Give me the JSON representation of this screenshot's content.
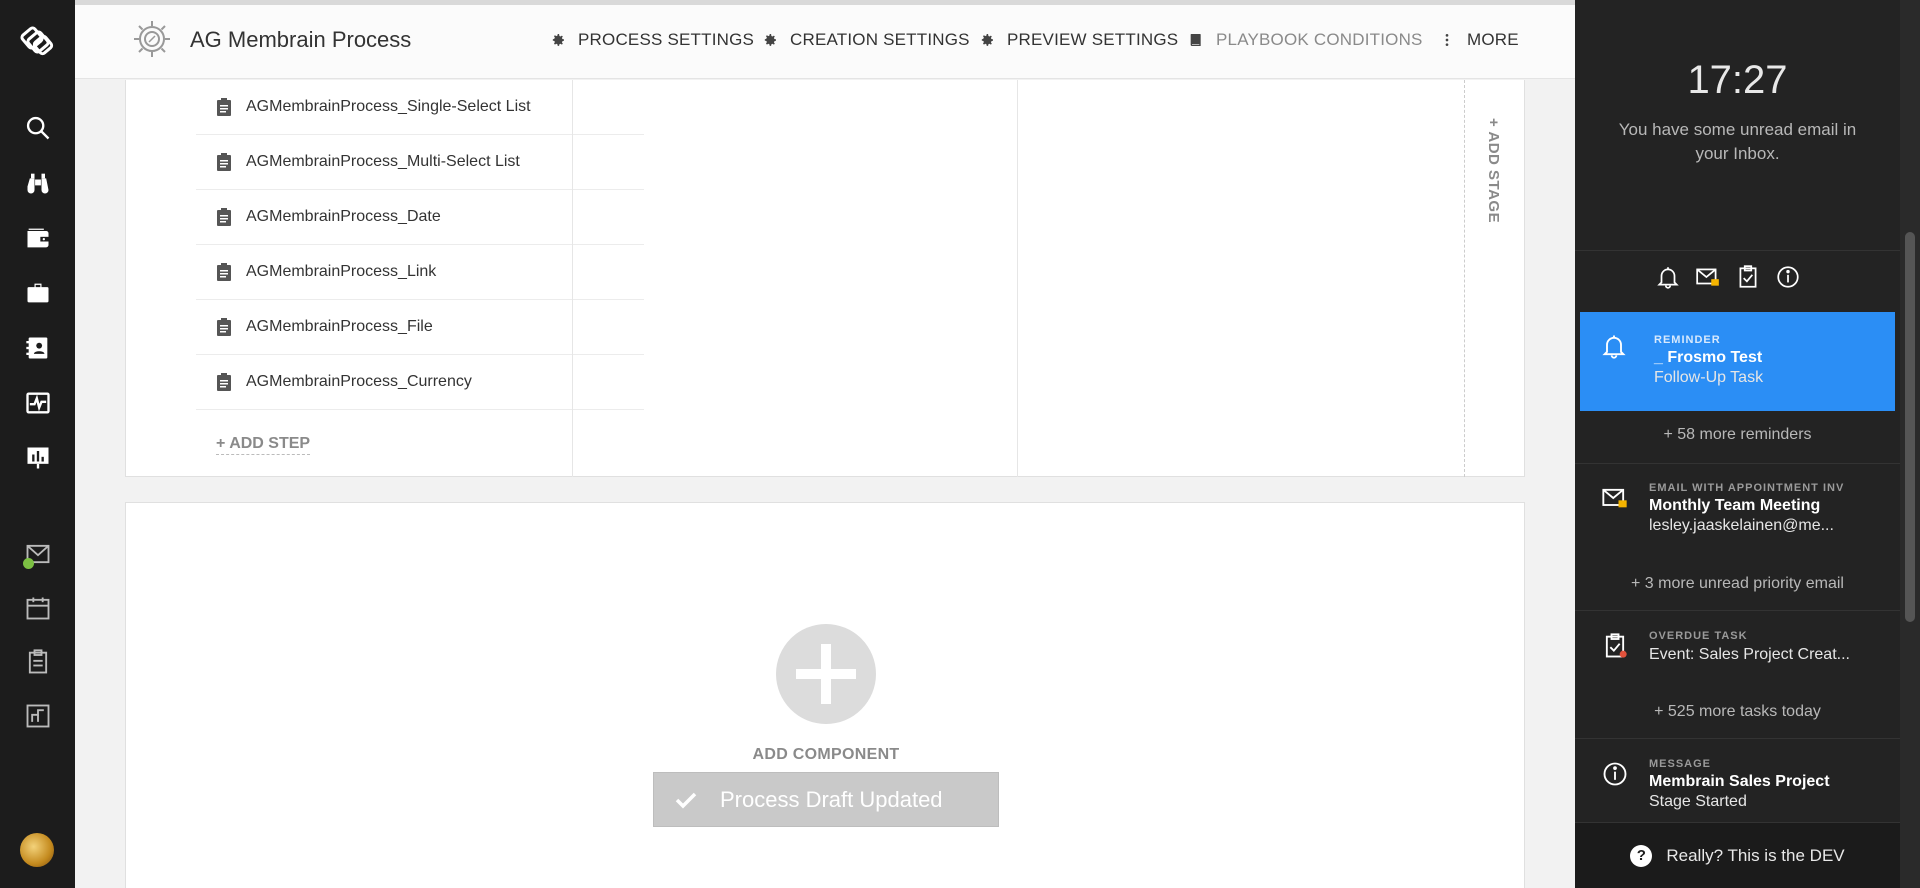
{
  "app": {
    "title": "AG Membrain Process"
  },
  "topmenu": [
    {
      "label": "PROCESS SETTINGS",
      "icon": "gear-icon"
    },
    {
      "label": "CREATION SETTINGS",
      "icon": "gear-icon"
    },
    {
      "label": "PREVIEW SETTINGS",
      "icon": "gear-icon"
    },
    {
      "label": "PLAYBOOK CONDITIONS",
      "icon": "book-icon"
    },
    {
      "label": "MORE",
      "icon": "kebab-icon"
    }
  ],
  "steps": [
    {
      "label": "AGMembrainProcess_Single-Select List"
    },
    {
      "label": "AGMembrainProcess_Multi-Select List"
    },
    {
      "label": "AGMembrainProcess_Date"
    },
    {
      "label": "AGMembrainProcess_Link"
    },
    {
      "label": "AGMembrainProcess_File"
    },
    {
      "label": "AGMembrainProcess_Currency"
    }
  ],
  "add_step_label": "+ ADD STEP",
  "add_stage_label": "+ ADD STAGE",
  "add_component_label": "ADD COMPONENT",
  "toast": {
    "message": "Process Draft Updated"
  },
  "panel": {
    "time": "17:27",
    "message": "You have some unread email in your Inbox.",
    "reminder": {
      "type": "REMINDER",
      "title": "_ Frosmo Test",
      "subtitle": "Follow-Up Task"
    },
    "more_reminders": "+ 58 more reminders",
    "email": {
      "type": "EMAIL WITH APPOINTMENT INV",
      "title": "Monthly Team Meeting",
      "subtitle": "lesley.jaaskelainen@me..."
    },
    "more_email": "+ 3 more unread priority email",
    "task": {
      "type": "OVERDUE TASK",
      "subtitle": "Event: Sales Project Creat..."
    },
    "more_tasks": "+ 525 more tasks today",
    "message_item": {
      "type": "MESSAGE",
      "title": "Membrain Sales Project",
      "subtitle": "Stage Started"
    },
    "footer": "Really? This is the DEV"
  },
  "colors": {
    "accent": "#2b8ef5",
    "nav_bg": "#1c1c1c",
    "panel_bg": "#232323"
  }
}
